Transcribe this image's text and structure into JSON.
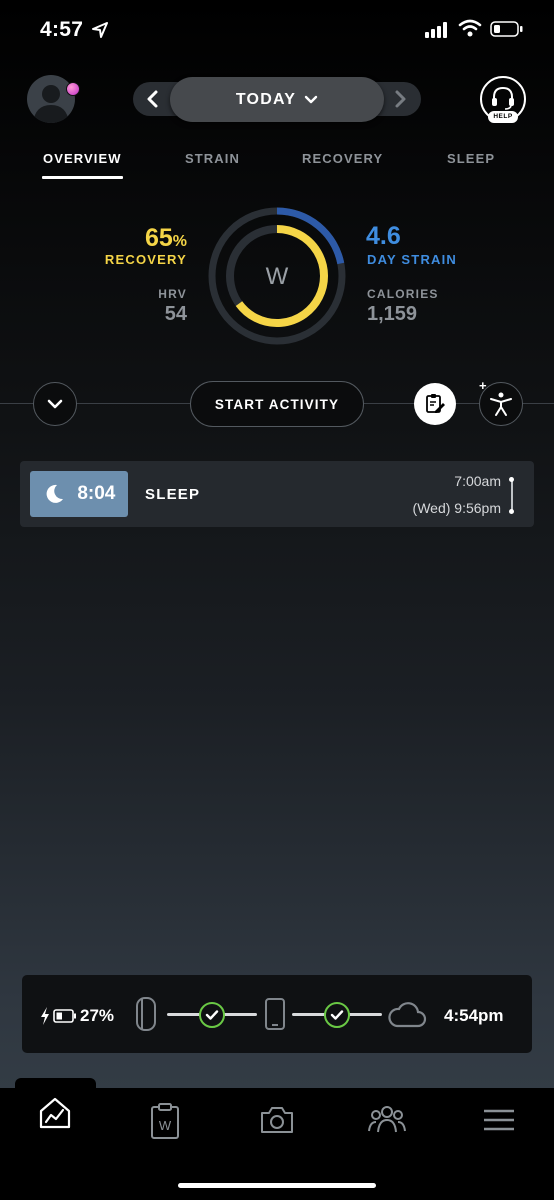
{
  "status_bar": {
    "time": "4:57"
  },
  "header": {
    "date_label": "TODAY",
    "help_label": "HELP"
  },
  "tabs": [
    {
      "label": "OVERVIEW",
      "active": true
    },
    {
      "label": "STRAIN",
      "active": false
    },
    {
      "label": "RECOVERY",
      "active": false
    },
    {
      "label": "SLEEP",
      "active": false
    }
  ],
  "overview": {
    "recovery": {
      "value": "65",
      "unit": "%",
      "label": "RECOVERY",
      "percent": 65,
      "color": "#f5d547"
    },
    "strain": {
      "value": "4.6",
      "label": "DAY STRAIN",
      "max": 21,
      "color": "#3f8de0"
    },
    "hrv": {
      "label": "HRV",
      "value": "54"
    },
    "calories": {
      "label": "CALORIES",
      "value": "1,159"
    },
    "logo": "W"
  },
  "actions": {
    "start_activity": "START ACTIVITY"
  },
  "activities": [
    {
      "duration": "8:04",
      "name": "SLEEP",
      "start": "7:00am",
      "end": "(Wed) 9:56pm",
      "icon": "moon-icon",
      "badge_color": "#6d8fae"
    }
  ],
  "sync": {
    "battery": "27%",
    "last_sync": "4:54pm"
  },
  "nav": [
    "home-icon",
    "journal-icon",
    "camera-icon",
    "team-icon",
    "menu-icon"
  ]
}
